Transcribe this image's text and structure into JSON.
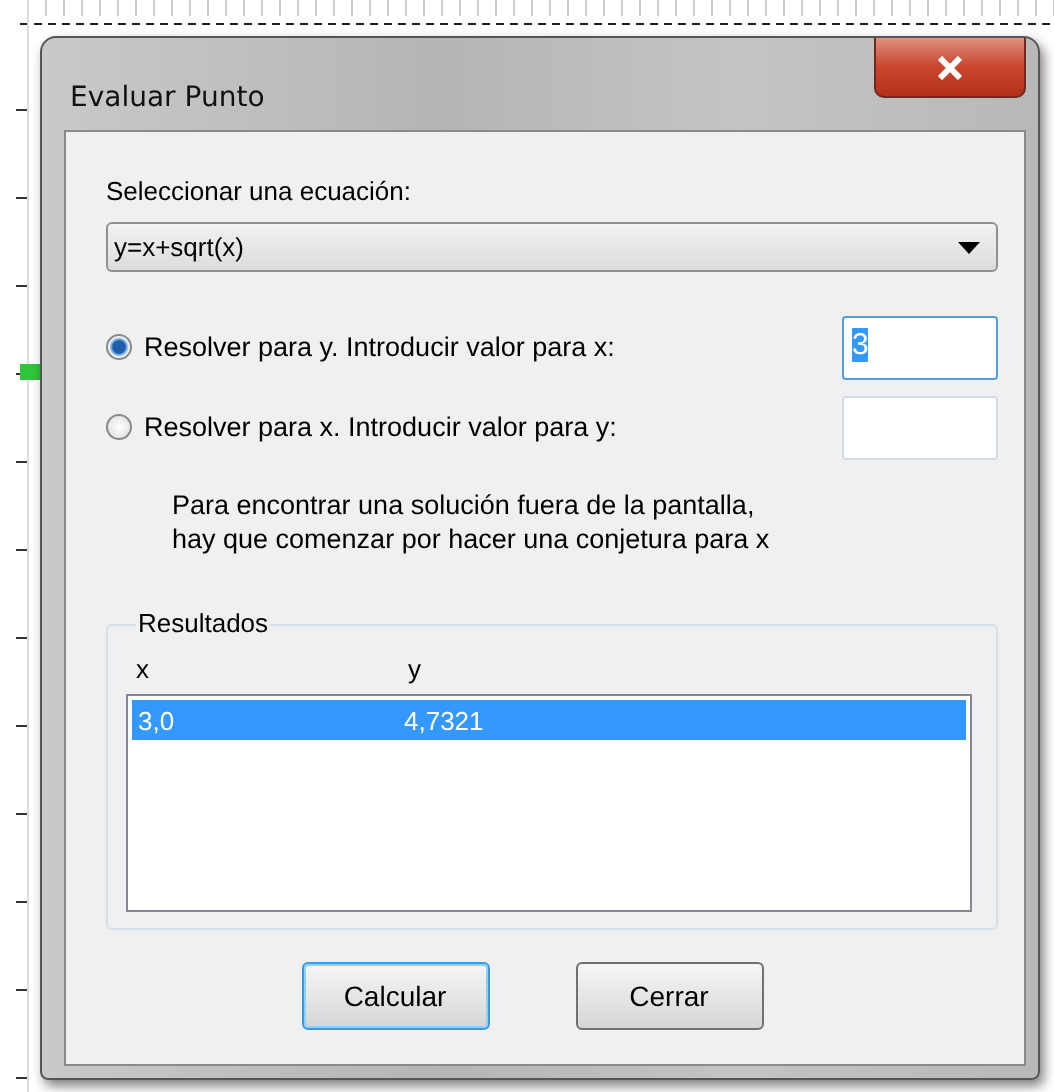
{
  "window": {
    "title": "Evaluar Punto"
  },
  "equation": {
    "label": "Seleccionar una ecuación:",
    "value": "y=x+sqrt(x)"
  },
  "solve_options": [
    {
      "label": "Resolver para  y.  Introducir valor para x:",
      "selected": true,
      "value": "3",
      "value_highlighted": true
    },
    {
      "label": "Resolver para  x.  Introducir valor para y:",
      "selected": false
    }
  ],
  "note": [
    "Para encontrar una solución fuera de la pantalla,",
    "hay que comenzar por hacer una conjetura para  x"
  ],
  "results": {
    "title": "Resultados",
    "columns": [
      "x",
      "y"
    ],
    "rows": [
      {
        "cells": [
          "3,0",
          "4,7321"
        ],
        "selected": true
      }
    ]
  },
  "buttons": [
    {
      "label": "Calcular",
      "default": true
    },
    {
      "label": "Cerrar",
      "default": false
    }
  ]
}
